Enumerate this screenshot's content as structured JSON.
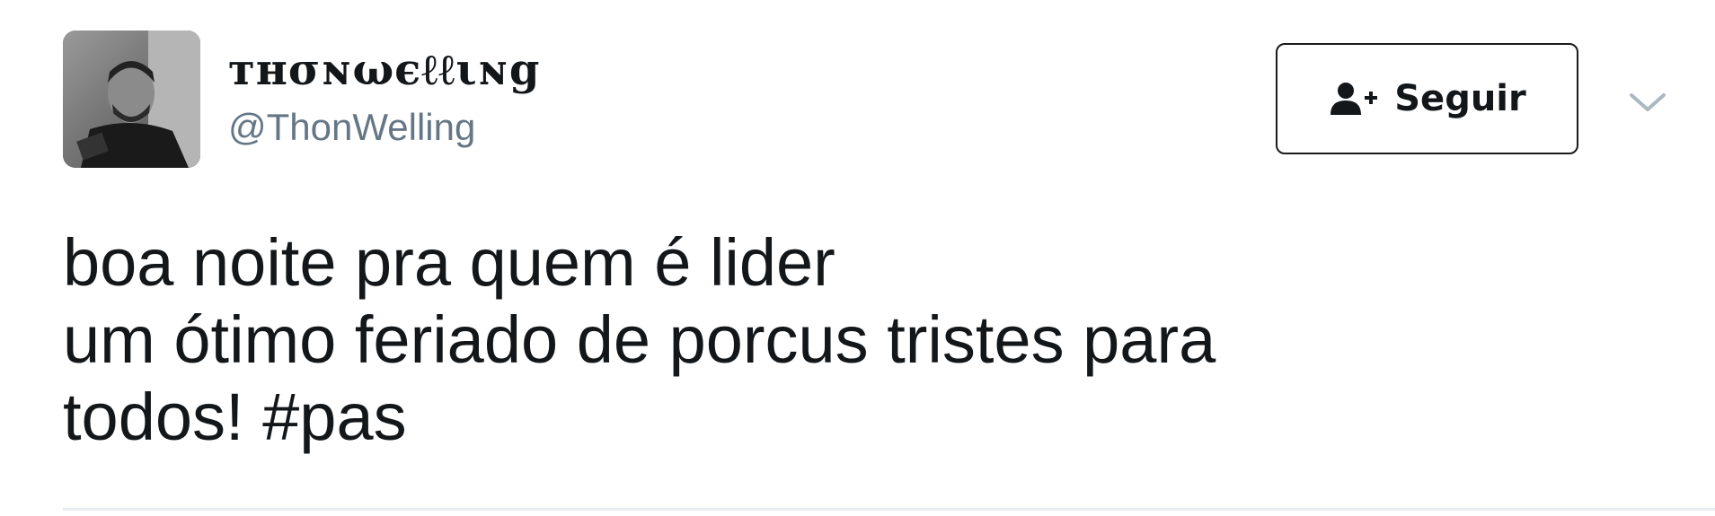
{
  "tweet": {
    "author": {
      "display_name": "ᴛʜσɴωєℓℓιɴg",
      "handle": "@ThonWelling"
    },
    "follow_button": {
      "label": "Seguir",
      "icon": "add-user-icon"
    },
    "menu_icon": "chevron-down-icon",
    "text_lines": [
      "boa noite pra quem é lider",
      "um ótimo feriado de porcus tristes para",
      "todos! "
    ],
    "hashtag": "#pas"
  }
}
